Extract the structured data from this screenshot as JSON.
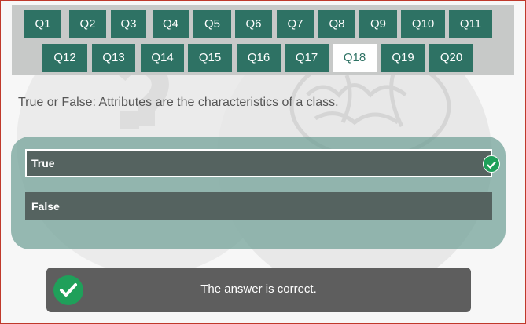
{
  "nav": {
    "questions": [
      "Q1",
      "Q2",
      "Q3",
      "Q4",
      "Q5",
      "Q6",
      "Q7",
      "Q8",
      "Q9",
      "Q10",
      "Q11",
      "Q12",
      "Q13",
      "Q14",
      "Q15",
      "Q16",
      "Q17",
      "Q18",
      "Q19",
      "Q20"
    ],
    "active": "Q18"
  },
  "question": {
    "text": "True or False: Attributes are the characteristics of a class."
  },
  "options": [
    {
      "label": "True",
      "selected": true,
      "status": "correct"
    },
    {
      "label": "False",
      "selected": false
    }
  ],
  "feedback": {
    "text": "The answer is correct.",
    "icon": "check-circle-icon"
  },
  "colors": {
    "nav_button": "#2e7264",
    "nav_active_bg": "#ffffff",
    "option_bg": "#556360",
    "panel_bg": "#6fa096",
    "feedback_bg": "#5e5e5e",
    "correct_green": "#1fa05a"
  }
}
